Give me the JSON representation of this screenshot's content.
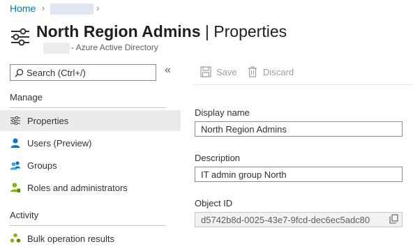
{
  "breadcrumb": {
    "home": "Home"
  },
  "header": {
    "title_bold": "North Region Admins",
    "title_sep": " | ",
    "title_rest": "Properties",
    "subtitle": "- Azure Active Directory"
  },
  "search": {
    "placeholder": "Search (Ctrl+/)"
  },
  "nav": {
    "manage_label": "Manage",
    "manage_items": [
      {
        "label": "Properties",
        "icon": "sliders-icon"
      },
      {
        "label": "Users (Preview)",
        "icon": "user-icon"
      },
      {
        "label": "Groups",
        "icon": "groups-icon"
      },
      {
        "label": "Roles and administrators",
        "icon": "roles-icon"
      }
    ],
    "activity_label": "Activity",
    "activity_items": [
      {
        "label": "Bulk operation results",
        "icon": "bulk-icon"
      }
    ]
  },
  "toolbar": {
    "save_label": "Save",
    "discard_label": "Discard"
  },
  "form": {
    "display_name_label": "Display name",
    "display_name_value": "North Region Admins",
    "description_label": "Description",
    "description_value": "IT admin group North",
    "object_id_label": "Object ID",
    "object_id_value": "d5742b8d-0025-43e7-9fcd-dec6ec5adc80"
  },
  "colors": {
    "accent": "#0078d4",
    "active_bg": "#edebe9",
    "person": "#0078d4",
    "roles": "#7fba00"
  }
}
